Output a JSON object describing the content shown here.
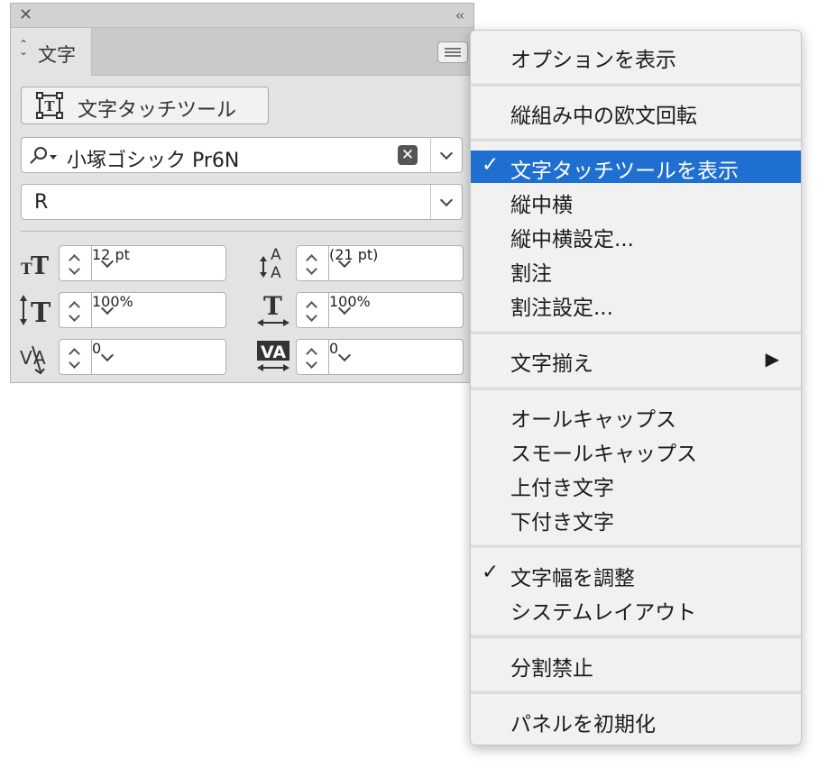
{
  "panel": {
    "tab_label": "文字",
    "touch_tool_label": "文字タッチツール",
    "font_family": "小塚ゴシック Pr6N",
    "font_style": "R",
    "font_size": "12 pt",
    "leading": "(21 pt)",
    "vertical_scale": "100%",
    "horizontal_scale": "100%",
    "kerning": "0",
    "tracking": "0"
  },
  "menu": {
    "items": [
      {
        "label": "オプションを表示"
      },
      {
        "label": "縦組み中の欧文回転"
      },
      {
        "label": "文字タッチツールを表示",
        "checked": true,
        "highlighted": true
      },
      {
        "label": "縦中横"
      },
      {
        "label": "縦中横設定..."
      },
      {
        "label": "割注"
      },
      {
        "label": "割注設定..."
      },
      {
        "label": "文字揃え",
        "submenu": true
      },
      {
        "label": "オールキャップス"
      },
      {
        "label": "スモールキャップス"
      },
      {
        "label": "上付き文字"
      },
      {
        "label": "下付き文字"
      },
      {
        "label": "文字幅を調整",
        "checked": true
      },
      {
        "label": "システムレイアウト"
      },
      {
        "label": "分割禁止"
      },
      {
        "label": "パネルを初期化"
      }
    ],
    "check_glyph": "✓",
    "submenu_glyph": "▶"
  },
  "colors": {
    "highlight": "#1f6fd0",
    "panel_bg": "#e3e3e3",
    "menu_bg": "#f1f1f1"
  }
}
